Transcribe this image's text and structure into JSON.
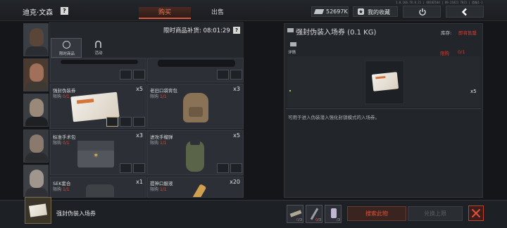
{
  "header": {
    "trader_name": "迪克·文森",
    "help_glyph": "?",
    "tabs": [
      {
        "label": "购买",
        "active": true
      },
      {
        "label": "出售",
        "active": false
      }
    ],
    "version": "1.0.166.78.8.21 | 0820Z18d | 09.21821 7821 | 欧服1-1",
    "money": "52697K",
    "favorites_label": "我的收藏"
  },
  "shop": {
    "restock_label": "限时商品补货: 08:01:29",
    "help_glyph": "?",
    "tabs": [
      {
        "label": "限时商品",
        "icon": "clock-icon",
        "active": true
      },
      {
        "label": "活动",
        "icon": "horseshoe-icon",
        "active": false
      }
    ],
    "limit_prefix": "限购",
    "items": [
      {
        "name": "强封伪装券",
        "limit_used": "0",
        "limit_total": "1",
        "qty": "x5",
        "icon": "ticket"
      },
      {
        "name": "老旧口袋背包",
        "limit_used": "1",
        "limit_total": "1",
        "qty": "x3",
        "icon": "backpack"
      },
      {
        "name": "标准手术包",
        "limit_used": "0",
        "limit_total": "1",
        "qty": "x3",
        "icon": "medkit"
      },
      {
        "name": "进攻手榴弹",
        "limit_used": "1",
        "limit_total": "1",
        "qty": "x5",
        "icon": "grenade"
      },
      {
        "name": "SEK套合",
        "limit_used": "1",
        "limit_total": "1",
        "qty": "x1",
        "icon": "vest"
      },
      {
        "name": "提神口服液",
        "limit_used": "1",
        "limit_total": "1",
        "qty": "x20",
        "icon": "vial"
      }
    ]
  },
  "detail": {
    "title": "强封伪装入场券 (0.1 KG)",
    "stock_label": "库存:",
    "stock_value": "即将售罄",
    "tag": "详情",
    "limit_label": "限购",
    "limit_value": "0/1",
    "qty": "x5",
    "description": "可用于进入伪装潜入强化封锁模式的入场券。"
  },
  "bottom": {
    "item_name": "强封伪装入场券",
    "requirements": [
      {
        "icon": "bar-icon",
        "have": "0",
        "need": "3"
      },
      {
        "icon": "knife-icon",
        "have": "0",
        "need": "3"
      },
      {
        "icon": "bottle-icon",
        "have": "",
        "need": "3"
      }
    ],
    "search_label": "搜索此物",
    "exchange_label": "兑换上限"
  },
  "colors": {
    "accent": "#e0503a",
    "warning": "#e0382b",
    "panel": "#24272c"
  }
}
